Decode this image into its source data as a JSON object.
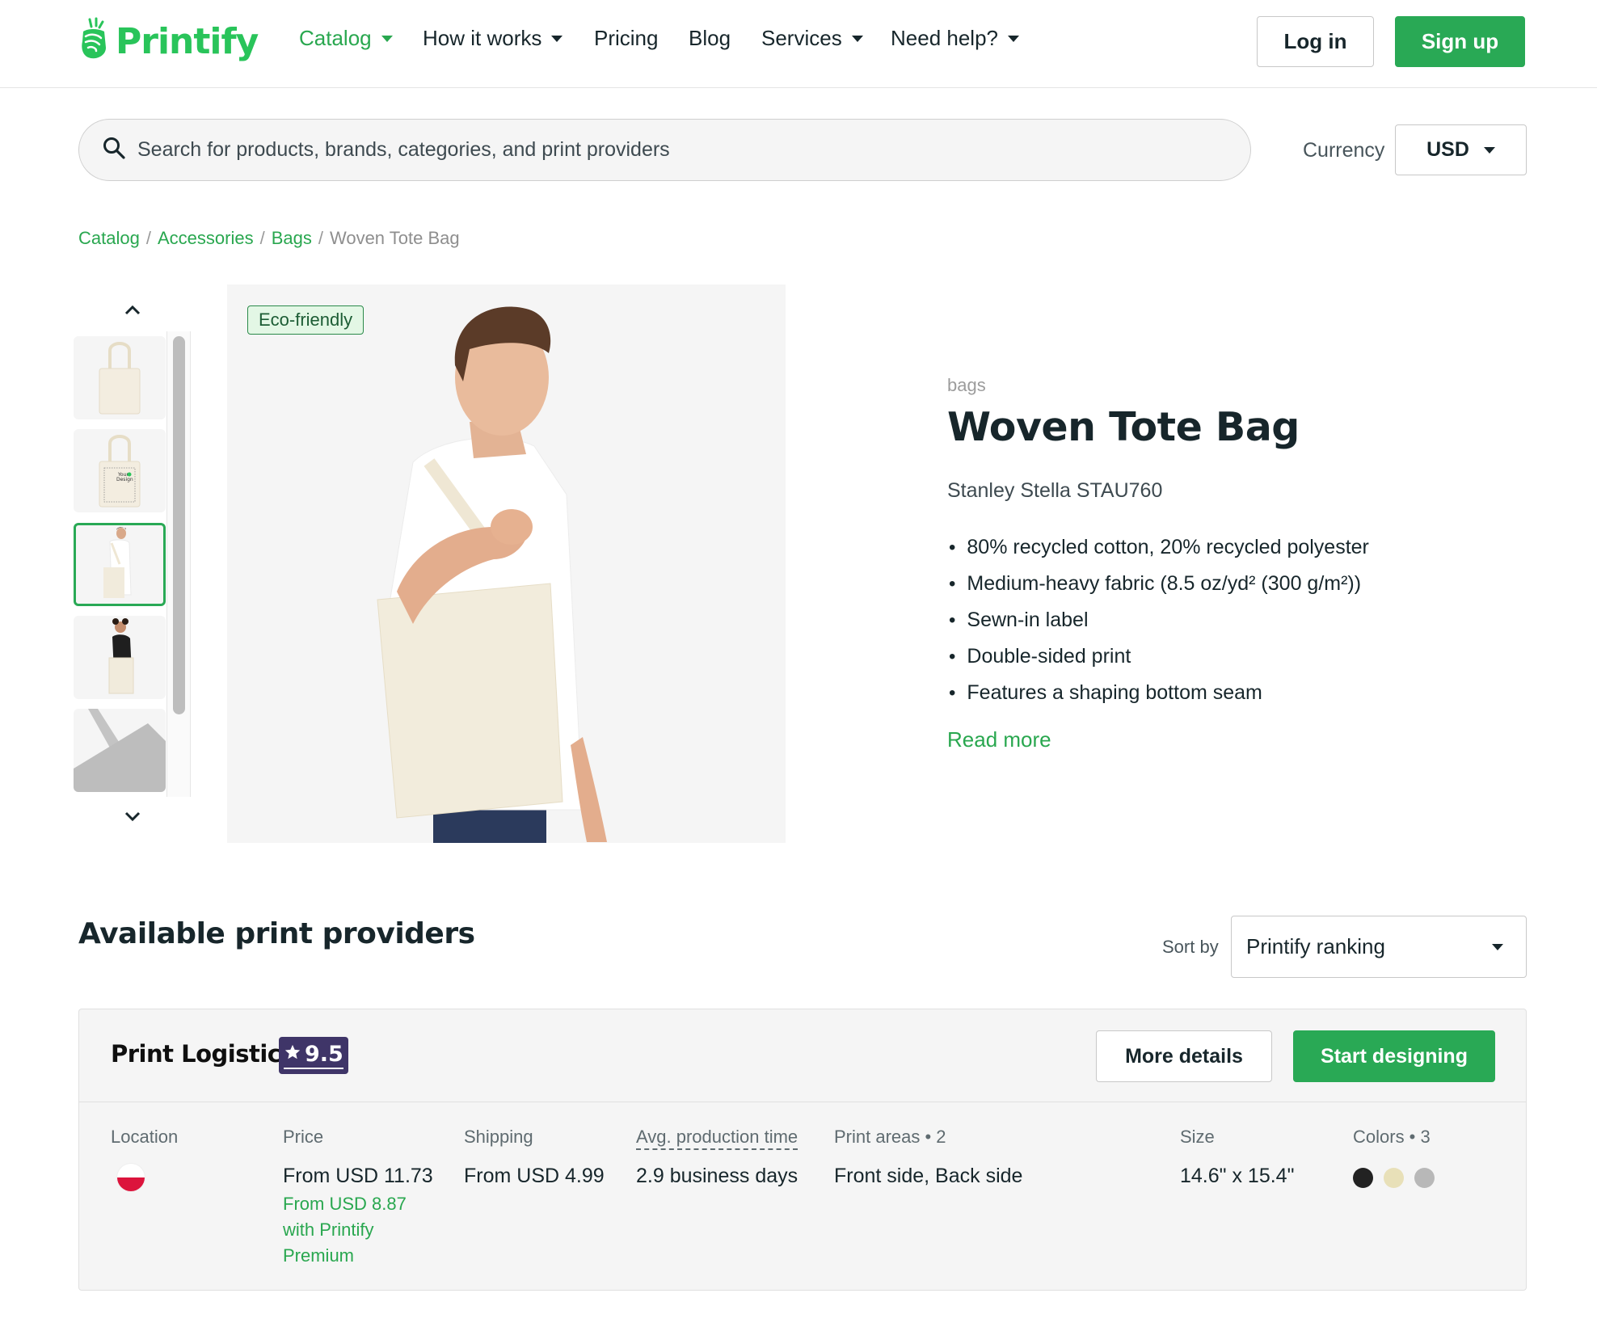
{
  "header": {
    "logo_text": "Printify",
    "nav": [
      {
        "label": "Catalog",
        "dropdown": true,
        "active": true
      },
      {
        "label": "How it works",
        "dropdown": true
      },
      {
        "label": "Pricing",
        "dropdown": false
      },
      {
        "label": "Blog",
        "dropdown": false
      },
      {
        "label": "Services",
        "dropdown": true
      },
      {
        "label": "Need help?",
        "dropdown": true
      }
    ],
    "login_label": "Log in",
    "signup_label": "Sign up"
  },
  "search": {
    "placeholder": "Search for products, brands, categories, and print providers",
    "value": ""
  },
  "currency": {
    "label": "Currency",
    "selected": "USD"
  },
  "breadcrumb": [
    {
      "label": "Catalog",
      "link": true
    },
    {
      "label": "Accessories",
      "link": true
    },
    {
      "label": "Bags",
      "link": true
    },
    {
      "label": "Woven Tote Bag",
      "link": false
    }
  ],
  "gallery": {
    "thumbnails": [
      {
        "alt": "Plain tote bag front"
      },
      {
        "alt": "Tote bag with Your Design print area"
      },
      {
        "alt": "Man carrying tote bag",
        "selected": true
      },
      {
        "alt": "Woman carrying tote bag"
      },
      {
        "alt": "Tote bag fabric close-up"
      }
    ],
    "badge": "Eco-friendly"
  },
  "product": {
    "category": "bags",
    "title": "Woven Tote Bag",
    "brand_model": "Stanley Stella STAU760",
    "features": [
      "80% recycled cotton, 20% recycled polyester",
      "Medium-heavy fabric (8.5 oz/yd² (300 g/m²))",
      "Sewn-in label",
      "Double-sided print",
      "Features a shaping bottom seam"
    ],
    "read_more": "Read more"
  },
  "providers": {
    "title": "Available print providers",
    "sort_label": "Sort by",
    "sort_selected": "Printify ranking",
    "items": [
      {
        "name": "Print Logistic",
        "rating": "9.5",
        "more_details": "More details",
        "start_designing": "Start designing",
        "columns": {
          "location": {
            "label": "Location",
            "value": "Poland"
          },
          "price": {
            "label": "Price",
            "value": "From USD 11.73",
            "premium": "From USD 8.87 with Printify Premium"
          },
          "shipping": {
            "label": "Shipping",
            "value": "From USD 4.99"
          },
          "production": {
            "label": "Avg. production time",
            "value": "2.9 business days"
          },
          "print_areas": {
            "label": "Print areas • 2",
            "value": "Front side, Back side"
          },
          "size": {
            "label": "Size",
            "value": "14.6\" x 15.4\""
          },
          "colors": {
            "label": "Colors • 3",
            "swatches": [
              "#222222",
              "#e8e0b8",
              "#b8b8b8"
            ]
          }
        }
      }
    ]
  },
  "colors": {
    "brand_green": "#29a955",
    "logo_green": "#29c45a",
    "rating_purple": "#3f3568"
  }
}
